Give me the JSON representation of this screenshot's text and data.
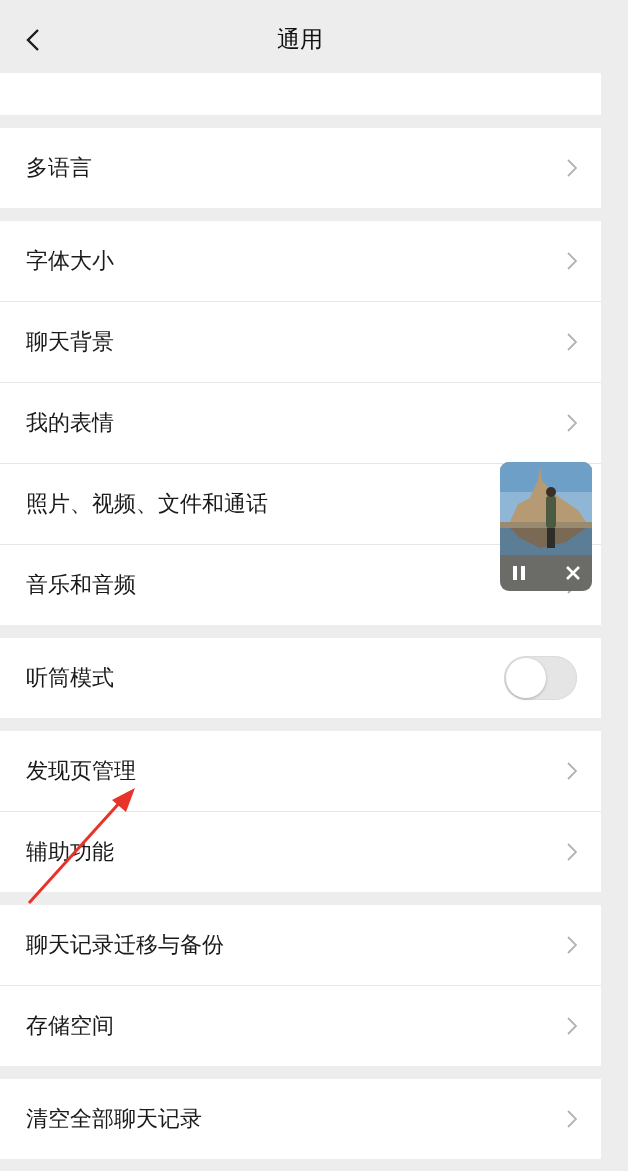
{
  "header": {
    "title": "通用"
  },
  "groups": [
    {
      "rows": [
        {
          "kind": "link",
          "label": "多语言"
        }
      ]
    },
    {
      "rows": [
        {
          "kind": "link",
          "label": "字体大小"
        },
        {
          "kind": "link",
          "label": "聊天背景"
        },
        {
          "kind": "link",
          "label": "我的表情"
        },
        {
          "kind": "link",
          "label": "照片、视频、文件和通话",
          "chevron_covered": true
        },
        {
          "kind": "link",
          "label": "音乐和音频"
        }
      ]
    },
    {
      "rows": [
        {
          "kind": "toggle",
          "label": "听筒模式",
          "on": false
        }
      ]
    },
    {
      "rows": [
        {
          "kind": "link",
          "label": "发现页管理"
        },
        {
          "kind": "link",
          "label": "辅助功能"
        }
      ]
    },
    {
      "rows": [
        {
          "kind": "link",
          "label": "聊天记录迁移与备份"
        },
        {
          "kind": "link",
          "label": "存储空间"
        }
      ]
    },
    {
      "rows": [
        {
          "kind": "link",
          "label": "清空全部聊天记录"
        }
      ]
    }
  ]
}
